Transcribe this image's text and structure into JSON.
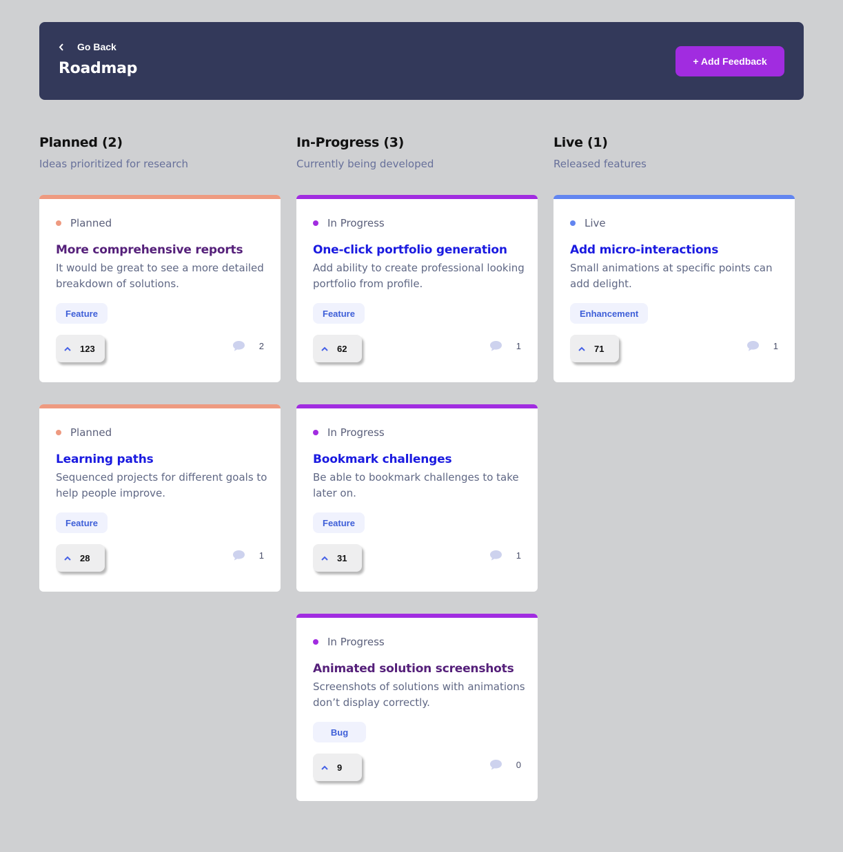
{
  "header": {
    "back_label": "Go Back",
    "title": "Roadmap",
    "add_label": "+ Add Feedback"
  },
  "colors": {
    "planned": "#ee9a80",
    "in_progress": "#a12ce0",
    "live": "#6285f0",
    "header_bg": "#33395a"
  },
  "columns": [
    {
      "title": "Planned (2)",
      "subtitle": "Ideas prioritized for research"
    },
    {
      "title": "In-Progress (3)",
      "subtitle": "Currently being developed"
    },
    {
      "title": "Live (1)",
      "subtitle": "Released features"
    }
  ],
  "cards": [
    {
      "status": "Planned",
      "title": "More comprehensive reports",
      "description": "It would be great to see a more detailed breakdown of solutions.",
      "tag": "Feature",
      "upvotes": "123",
      "comments": "2"
    },
    {
      "status": "Planned",
      "title": "Learning paths",
      "description": "Sequenced projects for different goals to help people improve.",
      "tag": "Feature",
      "upvotes": "28",
      "comments": "1"
    },
    {
      "status": "In Progress",
      "title": "One-click portfolio generation",
      "description": "Add ability to create professional looking portfolio from profile.",
      "tag": "Feature",
      "upvotes": "62",
      "comments": "1"
    },
    {
      "status": "In Progress",
      "title": "Bookmark challenges",
      "description": "Be able to bookmark challenges to take later on.",
      "tag": "Feature",
      "upvotes": "31",
      "comments": "1"
    },
    {
      "status": "In Progress",
      "title": "Animated solution screenshots",
      "description": "Screenshots of solutions with animations don’t display correctly.",
      "tag": "Bug",
      "upvotes": "9",
      "comments": "0"
    },
    {
      "status": "Live",
      "title": "Add micro-interactions",
      "description": "Small animations at specific points can add delight.",
      "tag": "Enhancement",
      "upvotes": "71",
      "comments": "1"
    }
  ]
}
